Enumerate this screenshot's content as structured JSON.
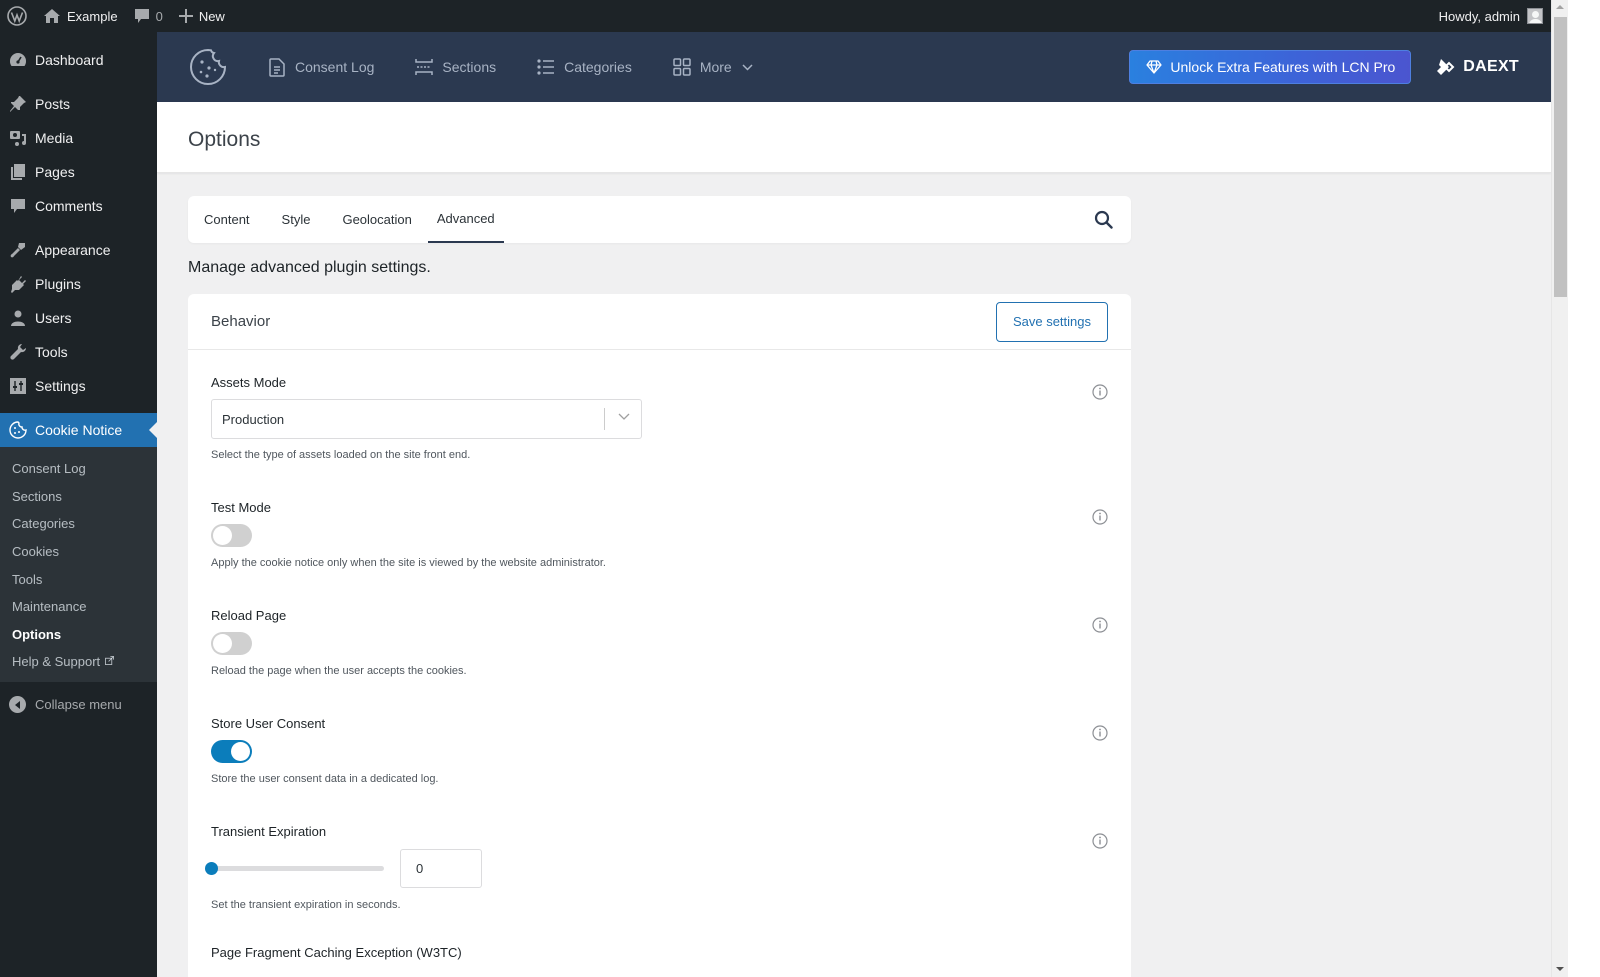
{
  "adminbar": {
    "site_name": "Example",
    "comments_count": "0",
    "new_label": "New",
    "greeting": "Howdy, admin"
  },
  "sidebar": {
    "items": [
      {
        "label": "Dashboard",
        "icon": "dashboard-icon"
      },
      {
        "label": "Posts",
        "icon": "pin-icon"
      },
      {
        "label": "Media",
        "icon": "media-icon"
      },
      {
        "label": "Pages",
        "icon": "pages-icon"
      },
      {
        "label": "Comments",
        "icon": "comment-icon"
      },
      {
        "label": "Appearance",
        "icon": "brush-icon"
      },
      {
        "label": "Plugins",
        "icon": "plug-icon"
      },
      {
        "label": "Users",
        "icon": "user-icon"
      },
      {
        "label": "Tools",
        "icon": "wrench-icon"
      },
      {
        "label": "Settings",
        "icon": "sliders-icon"
      }
    ],
    "current": {
      "label": "Cookie Notice",
      "icon": "cookie-icon"
    },
    "submenu": [
      {
        "label": "Consent Log",
        "active": false
      },
      {
        "label": "Sections",
        "active": false
      },
      {
        "label": "Categories",
        "active": false
      },
      {
        "label": "Cookies",
        "active": false
      },
      {
        "label": "Tools",
        "active": false
      },
      {
        "label": "Maintenance",
        "active": false
      },
      {
        "label": "Options",
        "active": true
      },
      {
        "label": "Help & Support",
        "active": false,
        "external": true
      }
    ],
    "collapse_label": "Collapse menu"
  },
  "plugin_header": {
    "nav": [
      {
        "label": "Consent Log",
        "icon": "document-icon"
      },
      {
        "label": "Sections",
        "icon": "sections-icon"
      },
      {
        "label": "Categories",
        "icon": "list-icon"
      },
      {
        "label": "More",
        "icon": "grid-icon"
      }
    ],
    "pro_button_label": "Unlock Extra Features with LCN Pro",
    "brand": "DAEXT",
    "colors": {
      "header_bg": "#2b3950",
      "pro_gradient_start": "#2a80df",
      "pro_gradient_end": "#4b55cf"
    }
  },
  "page": {
    "title": "Options",
    "tabs": [
      {
        "label": "Content",
        "active": false
      },
      {
        "label": "Style",
        "active": false
      },
      {
        "label": "Geolocation",
        "active": false
      },
      {
        "label": "Advanced",
        "active": true
      }
    ],
    "subtitle": "Manage advanced plugin settings."
  },
  "card": {
    "title": "Behavior",
    "save_label": "Save settings",
    "fields": {
      "assets_mode": {
        "label": "Assets Mode",
        "value": "Production",
        "description": "Select the type of assets loaded on the site front end."
      },
      "test_mode": {
        "label": "Test Mode",
        "enabled": false,
        "description": "Apply the cookie notice only when the site is viewed by the website administrator."
      },
      "reload_page": {
        "label": "Reload Page",
        "enabled": false,
        "description": "Reload the page when the user accepts the cookies."
      },
      "store_user_consent": {
        "label": "Store User Consent",
        "enabled": true,
        "description": "Store the user consent data in a dedicated log."
      },
      "transient_expiration": {
        "label": "Transient Expiration",
        "value": "0",
        "slider_fraction": 0,
        "description": "Set the transient expiration in seconds."
      },
      "page_fragment_caching": {
        "label": "Page Fragment Caching Exception (W3TC)"
      }
    }
  },
  "colors": {
    "accent": "#2271b1",
    "toggle_on": "#0b7dbb",
    "admin_dark": "#1d2327"
  }
}
